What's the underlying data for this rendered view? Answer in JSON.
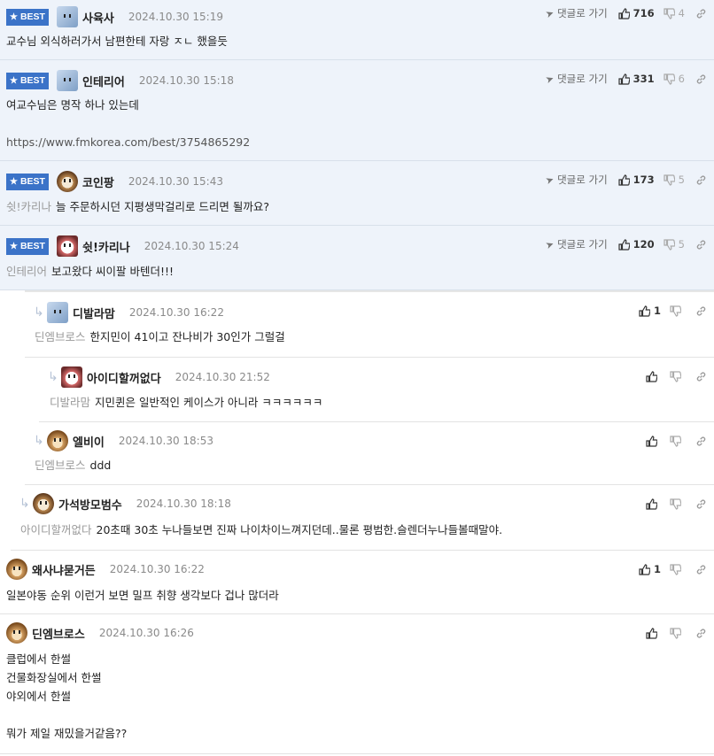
{
  "common": {
    "best_label": "BEST",
    "goto_label": "댓글로 가기"
  },
  "comments": [
    {
      "nick": "사육사",
      "date": "2024.10.30 15:19",
      "text": "교수님 외식하러가서 남편한테 자랑 ㅈㄴ 했을듯",
      "up": "716",
      "down": "4"
    },
    {
      "nick": "인테리어",
      "date": "2024.10.30 15:18",
      "text": "여교수님은 명작 하나 있는데",
      "link": "https://www.fmkorea.com/best/3754865292",
      "up": "331",
      "down": "6"
    },
    {
      "nick": "코인팡",
      "date": "2024.10.30 15:43",
      "mention": "쉿!카리나",
      "text": "늘 주문하시던 지평생막걸리로 드리면 될까요?",
      "up": "173",
      "down": "5"
    },
    {
      "nick": "쉿!카리나",
      "date": "2024.10.30 15:24",
      "mention": "인테리어",
      "text": "보고왔다 씨이팔 바텐더!!!",
      "up": "120",
      "down": "5"
    },
    {
      "nick": "디발라맘",
      "date": "2024.10.30 16:22",
      "mention": "딘엠브로스",
      "text": "한지민이 41이고 잔나비가 30인가 그럴걸",
      "up": "1"
    },
    {
      "nick": "아이디할꺼없다",
      "date": "2024.10.30 21:52",
      "mention": "디발라맘",
      "text": "지민퀸은 일반적인 케이스가 아니라 ㅋㅋㅋㅋㅋㅋ"
    },
    {
      "nick": "엘비이",
      "date": "2024.10.30 18:53",
      "mention": "딘엠브로스",
      "text": "ddd"
    },
    {
      "nick": "가석방모범수",
      "date": "2024.10.30 18:18",
      "mention": "아이디할꺼없다",
      "text": "20초때 30초 누나들보면 진짜 나이차이느껴지던데..물론 평범한.슬렌더누나들볼때말야."
    },
    {
      "nick": "왜사냐묻거든",
      "date": "2024.10.30 16:22",
      "text": "일본야동 순위 이런거 보면 밀프 취향 생각보다 겁나 많더라",
      "up": "1"
    },
    {
      "nick": "딘엠브로스",
      "date": "2024.10.30 16:26",
      "text": "클럽에서 한썰\n건물화장실에서 한썰\n야외에서 한썰\n\n뭐가 제일 재밌을거같음??"
    }
  ]
}
